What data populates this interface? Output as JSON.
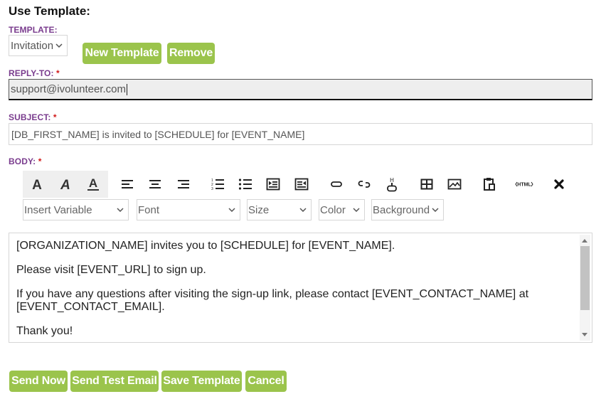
{
  "page_title": "Use Template:",
  "template": {
    "label": "TEMPLATE:",
    "selected": "Invitation",
    "new_button": "New Template",
    "remove_button": "Remove"
  },
  "reply_to": {
    "label": "REPLY-TO:",
    "required": "*",
    "value": "support@ivolunteer.com"
  },
  "subject": {
    "label": "SUBJECT:",
    "required": "*",
    "value": "[DB_FIRST_NAME] is invited to [SCHEDULE] for [EVENT_NAME]"
  },
  "body": {
    "label": "BODY:",
    "required": "*",
    "paragraphs": [
      "[ORGANIZATION_NAME] invites you to [SCHEDULE] for [EVENT_NAME].",
      "Please visit [EVENT_URL] to sign up.",
      "If you have any questions after visiting the sign-up link, please contact [EVENT_CONTACT_NAME] at [EVENT_CONTACT_EMAIL].",
      "Thank you!"
    ]
  },
  "toolbar": {
    "icons": [
      "bold-icon",
      "italic-icon",
      "underline-icon",
      "align-left-icon",
      "align-center-icon",
      "align-right-icon",
      "ordered-list-icon",
      "unordered-list-icon",
      "indent-icon",
      "outdent-icon",
      "link-icon",
      "unlink-icon",
      "hr-icon",
      "table-icon",
      "image-icon",
      "paste-icon",
      "html-icon",
      "clear-format-icon"
    ],
    "html_icon_text": "HTML",
    "dropdowns": {
      "insert_variable": "Insert Variable",
      "font": "Font",
      "size": "Size",
      "color": "Color",
      "background": "Background"
    }
  },
  "actions": {
    "send_now": "Send Now",
    "send_test": "Send Test Email",
    "save_template": "Save Template",
    "cancel": "Cancel"
  },
  "colors": {
    "label": "#7a3c8e",
    "button": "#9bc44c",
    "required": "#d11a1a"
  }
}
